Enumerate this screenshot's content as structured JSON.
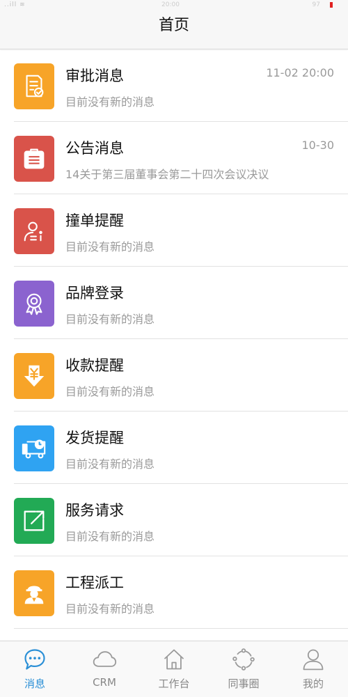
{
  "status_bar": {
    "signal": "..ill ≋",
    "time": "20:00",
    "battery": "97"
  },
  "header": {
    "title": "首页"
  },
  "messages": [
    {
      "name": "审批消息",
      "time": "11-02 20:00",
      "preview": "目前没有新的消息",
      "icon": "approval-doc-icon",
      "color": "#f7a428"
    },
    {
      "name": "公告消息",
      "time": "10-30",
      "preview": "14关于第三届董事会第二十四次会议决议",
      "icon": "briefcase-icon",
      "color": "#d9534a"
    },
    {
      "name": "撞单提醒",
      "time": "",
      "preview": "目前没有新的消息",
      "icon": "user-alert-icon",
      "color": "#d9534a"
    },
    {
      "name": "品牌登录",
      "time": "",
      "preview": "目前没有新的消息",
      "icon": "award-badge-icon",
      "color": "#8b63cf"
    },
    {
      "name": "收款提醒",
      "time": "",
      "preview": "目前没有新的消息",
      "icon": "yen-download-icon",
      "color": "#f7a428"
    },
    {
      "name": "发货提醒",
      "time": "",
      "preview": "目前没有新的消息",
      "icon": "delivery-truck-icon",
      "color": "#2fa3f2"
    },
    {
      "name": "服务请求",
      "time": "",
      "preview": "目前没有新的消息",
      "icon": "external-link-icon",
      "color": "#22aa55"
    },
    {
      "name": "工程派工",
      "time": "",
      "preview": "目前没有新的消息",
      "icon": "engineer-icon",
      "color": "#f7a428"
    }
  ],
  "tabbar": {
    "active_color": "#2a8fd6",
    "tabs": [
      {
        "label": "消息",
        "icon": "chat-bubble-icon",
        "active": true
      },
      {
        "label": "CRM",
        "icon": "cloud-icon",
        "active": false
      },
      {
        "label": "工作台",
        "icon": "house-icon",
        "active": false
      },
      {
        "label": "同事圈",
        "icon": "circle-dots-icon",
        "active": false
      },
      {
        "label": "我的",
        "icon": "person-icon",
        "active": false
      }
    ]
  }
}
